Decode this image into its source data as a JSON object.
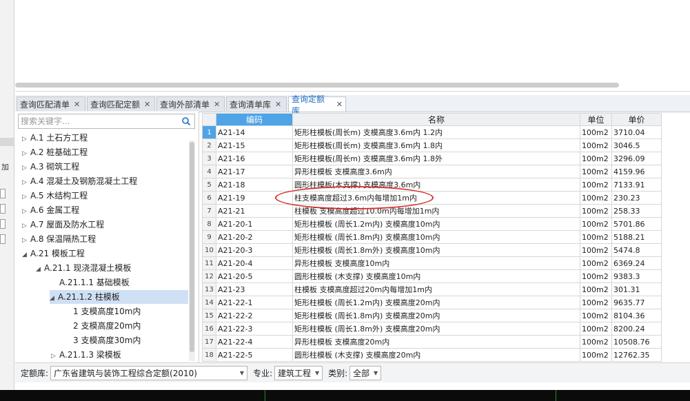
{
  "tabs": [
    {
      "label": "查询匹配清单",
      "close": "✕"
    },
    {
      "label": "查询匹配定额",
      "close": "✕"
    },
    {
      "label": "查询外部清单",
      "close": "✕"
    },
    {
      "label": "查询清单库",
      "close": "✕"
    },
    {
      "label": "查询定额库",
      "close": "✕",
      "active": true
    }
  ],
  "left_strip": {
    "text": "加"
  },
  "search": {
    "placeholder": "搜索关键字..."
  },
  "tree": [
    {
      "label": "A.1 土石方工程",
      "arrow": "▷"
    },
    {
      "label": "A.2 桩基础工程",
      "arrow": "▷"
    },
    {
      "label": "A.3 砌筑工程",
      "arrow": "▷"
    },
    {
      "label": "A.4 混凝土及钢筋混凝土工程",
      "arrow": "▷"
    },
    {
      "label": "A.5 木结构工程",
      "arrow": "▷"
    },
    {
      "label": "A.6 金属工程",
      "arrow": "▷"
    },
    {
      "label": "A.7 屋面及防水工程",
      "arrow": "▷"
    },
    {
      "label": "A.8 保温隔热工程",
      "arrow": "▷"
    },
    {
      "label": "A.21 模板工程",
      "arrow": "◢"
    },
    {
      "label": "A.21.1 现浇混凝土模板",
      "arrow": "◢"
    },
    {
      "label": "A.21.1.1 基础模板",
      "arrow": ""
    },
    {
      "label": "A.21.1.2 柱模板",
      "arrow": "◢",
      "selected": true
    },
    {
      "label": "1 支模高度10m内",
      "arrow": ""
    },
    {
      "label": "2 支模高度20m内",
      "arrow": ""
    },
    {
      "label": "3 支模高度30m内",
      "arrow": ""
    },
    {
      "label": "A.21.1.3 梁模板",
      "arrow": "▷"
    }
  ],
  "grid": {
    "headers": {
      "code": "编码",
      "name": "名称",
      "unit": "单位",
      "price": "单价"
    },
    "rows": [
      {
        "no": "1",
        "code": "A21-14",
        "name": "矩形柱模板(周长m) 支模高度3.6m内 1.2内",
        "unit": "100m2",
        "price": "3710.04"
      },
      {
        "no": "2",
        "code": "A21-15",
        "name": "矩形柱模板(周长m) 支模高度3.6m内 1.8内",
        "unit": "100m2",
        "price": "3046.5"
      },
      {
        "no": "3",
        "code": "A21-16",
        "name": "矩形柱模板(周长m) 支模高度3.6m内 1.8外",
        "unit": "100m2",
        "price": "3296.09"
      },
      {
        "no": "4",
        "code": "A21-17",
        "name": "异形柱模板 支模高度3.6m内",
        "unit": "100m2",
        "price": "4159.96"
      },
      {
        "no": "5",
        "code": "A21-18",
        "name": "圆形柱模板(木支撑) 支模高度3.6m内",
        "unit": "100m2",
        "price": "7133.91"
      },
      {
        "no": "6",
        "code": "A21-19",
        "name": "柱支模高度超过3.6m内每增加1m内",
        "unit": "100m2",
        "price": "230.23"
      },
      {
        "no": "7",
        "code": "A21-21",
        "name": "柱模板 支模高度超过10.0m内每增加1m内",
        "unit": "100m2",
        "price": "258.33"
      },
      {
        "no": "8",
        "code": "A21-20-1",
        "name": "矩形柱模板 (周长1.2m内) 支模高度10m内",
        "unit": "100m2",
        "price": "5701.86"
      },
      {
        "no": "9",
        "code": "A21-20-2",
        "name": "矩形柱模板 (周长1.8m内) 支模高度10m内",
        "unit": "100m2",
        "price": "5188.21"
      },
      {
        "no": "10",
        "code": "A21-20-3",
        "name": "矩形柱模板 (周长1.8m外) 支模高度10m内",
        "unit": "100m2",
        "price": "5474.8"
      },
      {
        "no": "11",
        "code": "A21-20-4",
        "name": "异形柱模板 支模高度10m内",
        "unit": "100m2",
        "price": "6369.24"
      },
      {
        "no": "12",
        "code": "A21-20-5",
        "name": "圆形柱模板 (木支撑) 支模高度10m内",
        "unit": "100m2",
        "price": "9383.3"
      },
      {
        "no": "13",
        "code": "A21-23",
        "name": "柱模板 支模高度超过20m内每增加1m内",
        "unit": "100m2",
        "price": "301.31"
      },
      {
        "no": "14",
        "code": "A21-22-1",
        "name": "矩形柱模板 (周长1.2m内) 支模高度20m内",
        "unit": "100m2",
        "price": "9635.77"
      },
      {
        "no": "15",
        "code": "A21-22-2",
        "name": "矩形柱模板 (周长1.8m内) 支模高度20m内",
        "unit": "100m2",
        "price": "8104.36"
      },
      {
        "no": "16",
        "code": "A21-22-3",
        "name": "矩形柱模板 (周长1.8m外) 支模高度20m内",
        "unit": "100m2",
        "price": "8200.24"
      },
      {
        "no": "17",
        "code": "A21-22-4",
        "name": "异形柱模板 支模高度20m内",
        "unit": "100m2",
        "price": "10508.76"
      },
      {
        "no": "18",
        "code": "A21-22-5",
        "name": "圆形柱模板 (木支撑) 支模高度20m内",
        "unit": "100m2",
        "price": "12762.35"
      }
    ]
  },
  "bottom": {
    "quota_label": "定额库:",
    "quota_value": "广东省建筑与装饰工程综合定额(2010)",
    "major_label": "专业:",
    "major_value": "建筑工程",
    "category_label": "类别:",
    "category_value": "全部",
    "dropdown_glyph": "▼"
  },
  "colors": {
    "accent": "#4ea4e6",
    "annotation": "#d83131",
    "selected": "#cfe0f4"
  }
}
